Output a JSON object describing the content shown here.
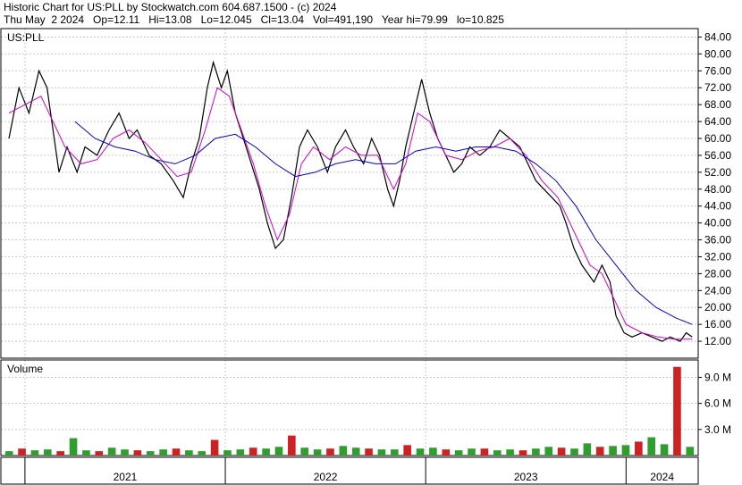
{
  "header": {
    "line1": "Historic Chart for US:PLL by Stockwatch.com 604.687.1500 - (c) 2024",
    "line2": "Thu May  2 2024   Op=12.11   Hi=13.08   Lo=12.045   Cl=13.04   Vol=491,190   Year hi=79.99   lo=10.825"
  },
  "chart_data": [
    {
      "type": "line",
      "title": "US:PLL",
      "ylim": [
        8,
        86
      ],
      "y_ticks": [
        "84.00",
        "80.00",
        "76.00",
        "72.00",
        "68.00",
        "64.00",
        "60.00",
        "56.00",
        "52.00",
        "48.00",
        "44.00",
        "40.00",
        "36.00",
        "32.00",
        "28.00",
        "24.00",
        "20.00",
        "16.00",
        "12.00"
      ],
      "x_labels": [
        "2021",
        "2022",
        "2023",
        "2024"
      ],
      "grid": true,
      "series": [],
      "price_path": [
        [
          2020.92,
          60
        ],
        [
          2020.97,
          72
        ],
        [
          2021.02,
          66
        ],
        [
          2021.07,
          76
        ],
        [
          2021.11,
          72
        ],
        [
          2021.14,
          62
        ],
        [
          2021.17,
          52
        ],
        [
          2021.21,
          58
        ],
        [
          2021.26,
          52
        ],
        [
          2021.3,
          58
        ],
        [
          2021.36,
          56
        ],
        [
          2021.42,
          62
        ],
        [
          2021.47,
          66
        ],
        [
          2021.52,
          60
        ],
        [
          2021.56,
          62
        ],
        [
          2021.62,
          56
        ],
        [
          2021.68,
          54
        ],
        [
          2021.74,
          50
        ],
        [
          2021.79,
          46
        ],
        [
          2021.83,
          54
        ],
        [
          2021.87,
          60
        ],
        [
          2021.91,
          72
        ],
        [
          2021.94,
          78
        ],
        [
          2021.98,
          72
        ],
        [
          2022.01,
          76
        ],
        [
          2022.05,
          66
        ],
        [
          2022.09,
          60
        ],
        [
          2022.13,
          54
        ],
        [
          2022.17,
          48
        ],
        [
          2022.21,
          40
        ],
        [
          2022.25,
          34
        ],
        [
          2022.29,
          36
        ],
        [
          2022.33,
          46
        ],
        [
          2022.37,
          58
        ],
        [
          2022.41,
          62
        ],
        [
          2022.46,
          58
        ],
        [
          2022.51,
          52
        ],
        [
          2022.55,
          58
        ],
        [
          2022.6,
          62
        ],
        [
          2022.64,
          58
        ],
        [
          2022.69,
          54
        ],
        [
          2022.73,
          60
        ],
        [
          2022.77,
          56
        ],
        [
          2022.81,
          48
        ],
        [
          2022.84,
          44
        ],
        [
          2022.87,
          50
        ],
        [
          2022.9,
          58
        ],
        [
          2022.94,
          66
        ],
        [
          2022.98,
          74
        ],
        [
          2023.02,
          66
        ],
        [
          2023.06,
          60
        ],
        [
          2023.1,
          56
        ],
        [
          2023.14,
          52
        ],
        [
          2023.18,
          54
        ],
        [
          2023.22,
          58
        ],
        [
          2023.27,
          56
        ],
        [
          2023.32,
          58
        ],
        [
          2023.37,
          62
        ],
        [
          2023.42,
          60
        ],
        [
          2023.47,
          58
        ],
        [
          2023.51,
          54
        ],
        [
          2023.55,
          50
        ],
        [
          2023.59,
          48
        ],
        [
          2023.63,
          46
        ],
        [
          2023.67,
          44
        ],
        [
          2023.7,
          40
        ],
        [
          2023.74,
          34
        ],
        [
          2023.78,
          30
        ],
        [
          2023.81,
          28
        ],
        [
          2023.84,
          26
        ],
        [
          2023.88,
          30
        ],
        [
          2023.92,
          26
        ],
        [
          2023.95,
          18
        ],
        [
          2023.99,
          14
        ],
        [
          2024.03,
          13
        ],
        [
          2024.08,
          14
        ],
        [
          2024.13,
          13
        ],
        [
          2024.18,
          12
        ],
        [
          2024.22,
          13
        ],
        [
          2024.27,
          12
        ],
        [
          2024.3,
          14
        ],
        [
          2024.33,
          13.04
        ]
      ],
      "ma_short": [
        [
          2020.92,
          66
        ],
        [
          2021.0,
          68
        ],
        [
          2021.08,
          70
        ],
        [
          2021.14,
          64
        ],
        [
          2021.2,
          58
        ],
        [
          2021.28,
          54
        ],
        [
          2021.36,
          55
        ],
        [
          2021.44,
          60
        ],
        [
          2021.52,
          62
        ],
        [
          2021.6,
          59
        ],
        [
          2021.68,
          55
        ],
        [
          2021.76,
          51
        ],
        [
          2021.83,
          52
        ],
        [
          2021.9,
          62
        ],
        [
          2021.96,
          72
        ],
        [
          2022.02,
          70
        ],
        [
          2022.08,
          62
        ],
        [
          2022.14,
          54
        ],
        [
          2022.2,
          44
        ],
        [
          2022.26,
          36
        ],
        [
          2022.32,
          42
        ],
        [
          2022.38,
          54
        ],
        [
          2022.44,
          58
        ],
        [
          2022.52,
          55
        ],
        [
          2022.6,
          58
        ],
        [
          2022.68,
          56
        ],
        [
          2022.76,
          56
        ],
        [
          2022.84,
          48
        ],
        [
          2022.9,
          54
        ],
        [
          2022.96,
          66
        ],
        [
          2023.02,
          64
        ],
        [
          2023.1,
          56
        ],
        [
          2023.18,
          55
        ],
        [
          2023.26,
          57
        ],
        [
          2023.34,
          58
        ],
        [
          2023.42,
          60
        ],
        [
          2023.5,
          56
        ],
        [
          2023.58,
          50
        ],
        [
          2023.66,
          46
        ],
        [
          2023.74,
          38
        ],
        [
          2023.82,
          30
        ],
        [
          2023.88,
          28
        ],
        [
          2023.94,
          22
        ],
        [
          2024.0,
          16
        ],
        [
          2024.08,
          14
        ],
        [
          2024.16,
          13
        ],
        [
          2024.24,
          12.5
        ],
        [
          2024.33,
          12.5
        ]
      ],
      "ma_long": [
        [
          2021.25,
          64
        ],
        [
          2021.35,
          60
        ],
        [
          2021.45,
          58
        ],
        [
          2021.55,
          57
        ],
        [
          2021.65,
          55
        ],
        [
          2021.75,
          54
        ],
        [
          2021.85,
          56
        ],
        [
          2021.95,
          60
        ],
        [
          2022.05,
          61
        ],
        [
          2022.15,
          58
        ],
        [
          2022.25,
          54
        ],
        [
          2022.35,
          51
        ],
        [
          2022.45,
          52
        ],
        [
          2022.55,
          54
        ],
        [
          2022.65,
          55
        ],
        [
          2022.75,
          54
        ],
        [
          2022.85,
          54
        ],
        [
          2022.95,
          57
        ],
        [
          2023.05,
          58
        ],
        [
          2023.15,
          57
        ],
        [
          2023.25,
          58
        ],
        [
          2023.35,
          58
        ],
        [
          2023.45,
          57
        ],
        [
          2023.55,
          54
        ],
        [
          2023.65,
          50
        ],
        [
          2023.75,
          44
        ],
        [
          2023.85,
          36
        ],
        [
          2023.95,
          30
        ],
        [
          2024.05,
          24
        ],
        [
          2024.15,
          20
        ],
        [
          2024.25,
          17.5
        ],
        [
          2024.33,
          16
        ]
      ]
    },
    {
      "type": "bar",
      "title": "Volume",
      "ylim": [
        0,
        11
      ],
      "y_ticks": [
        "9.0 M",
        "6.0 M",
        "3.0 M"
      ],
      "series": [
        {
          "values": [
            0.5,
            0.8,
            0.6,
            0.7,
            0.5,
            2.0,
            0.6,
            0.5,
            0.9,
            0.7,
            0.6,
            0.5,
            0.7,
            0.8,
            0.6,
            0.5,
            1.8,
            0.6,
            0.7,
            0.9,
            0.8,
            1.0,
            2.3,
            0.9,
            0.7,
            0.8,
            1.1,
            0.9,
            0.8,
            0.7,
            0.7,
            1.2,
            0.8,
            0.9,
            0.7,
            0.6,
            0.8,
            0.8,
            0.6,
            0.7,
            0.6,
            0.8,
            1.0,
            0.9,
            0.8,
            1.4,
            1.0,
            1.1,
            1.2,
            1.6,
            2.1,
            1.3,
            10.2,
            1.0
          ]
        }
      ]
    }
  ]
}
